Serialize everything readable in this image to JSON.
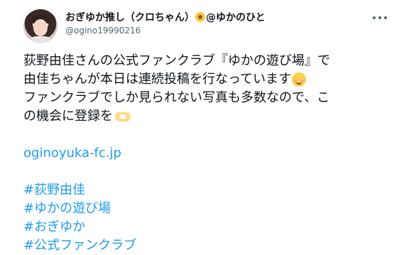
{
  "author": {
    "display_name": "おぎゆか推し（クロちゃん）",
    "display_name_suffix": "@ゆかのひと",
    "handle": "@ogino19990216",
    "badge_icon": "sunflower-icon"
  },
  "tweet": {
    "lines": [
      "荻野由佳さんの公式ファンクラブ『ゆかの遊び場』で",
      "由佳ちゃんが本日は連続投稿を行なっています",
      "ファンクラブでしか見られない写真も多数なので、こ",
      "の機会に登録を"
    ],
    "emojis": [
      "smiling-face-icon",
      "heart-hands-icon"
    ],
    "link": "oginoyuka-fc.jp",
    "hashtags": [
      "#荻野由佳",
      "#ゆかの遊び場",
      "#おぎゆか",
      "#公式ファンクラブ"
    ]
  },
  "colors": {
    "link": "#1d9bf0",
    "secondary_text": "#536471",
    "text": "#0f1419"
  }
}
